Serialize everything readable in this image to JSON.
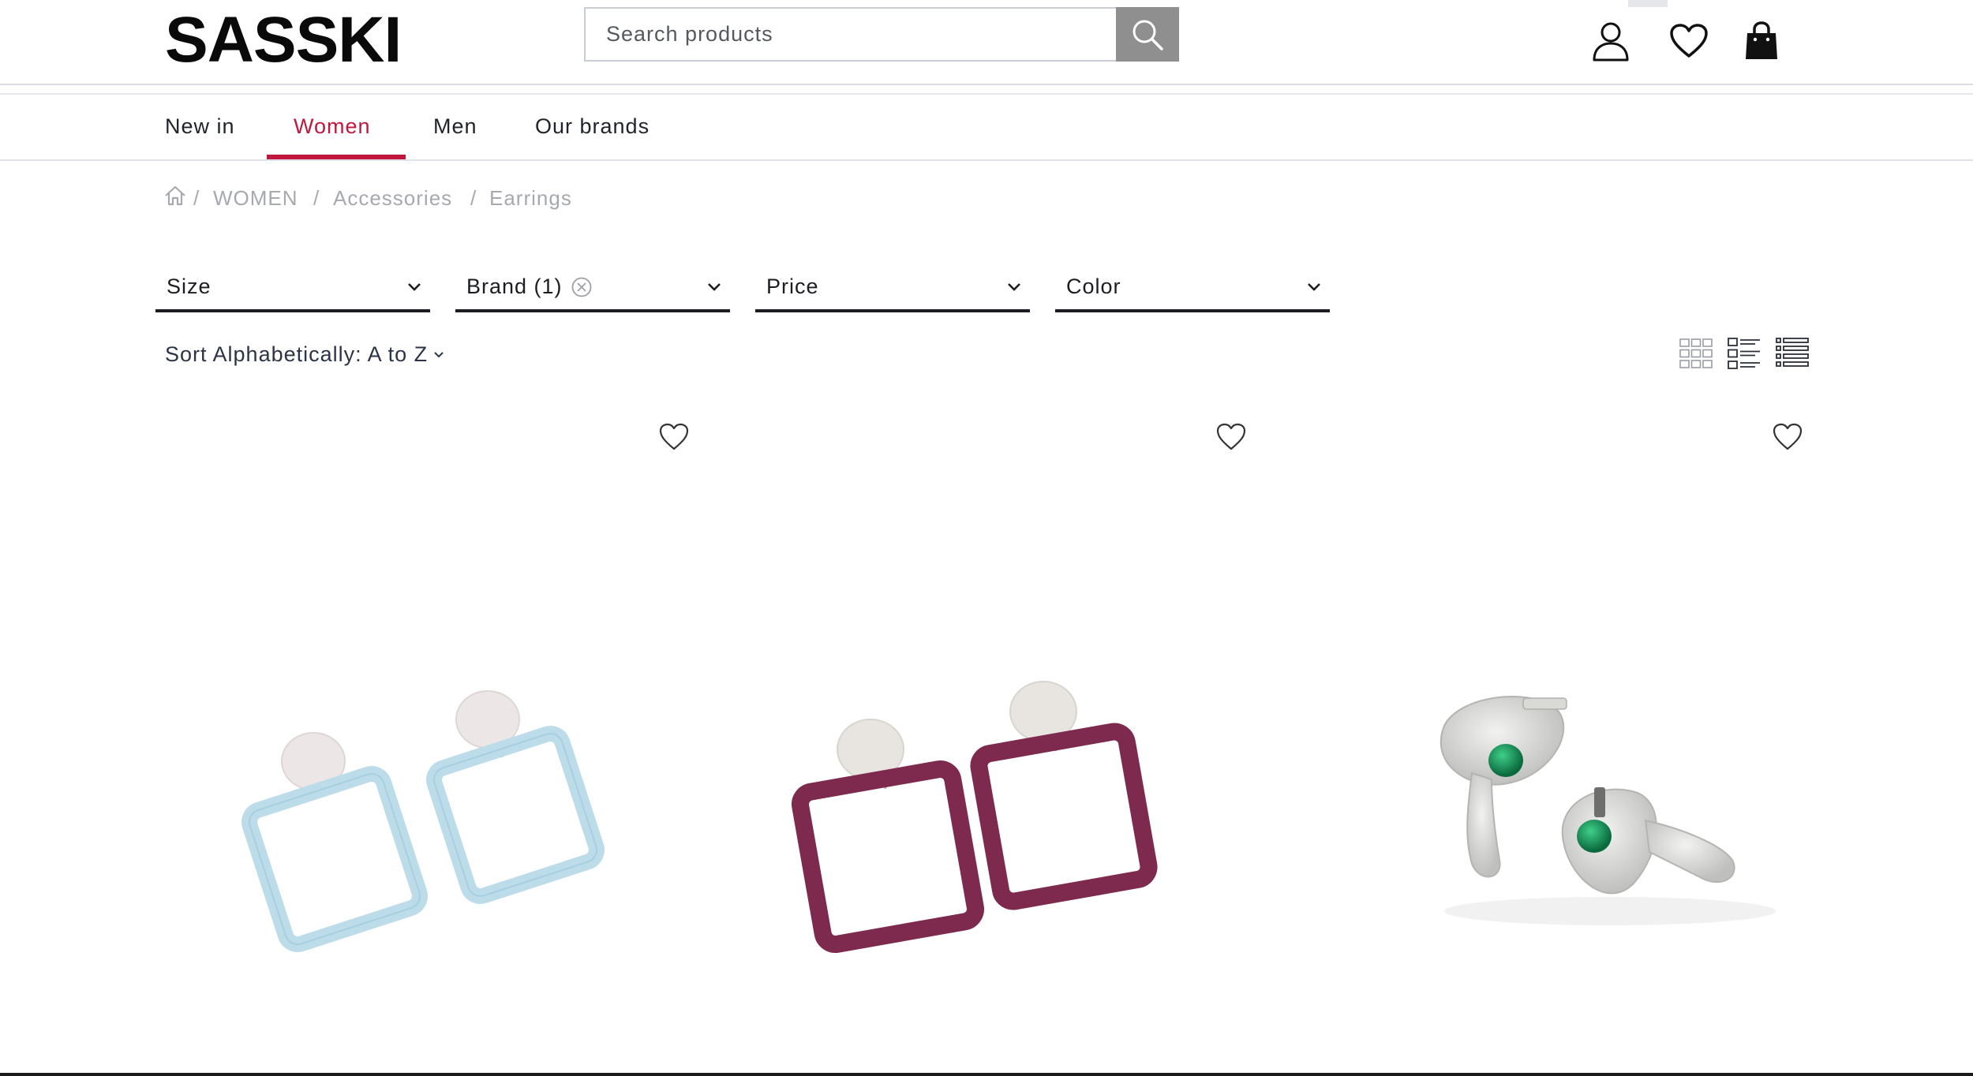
{
  "header": {
    "logo": "SASSKI",
    "search_placeholder": "Search products",
    "icons": [
      "user-icon",
      "heart-icon",
      "shopping-bag-icon"
    ]
  },
  "nav": {
    "items": [
      {
        "label": "New in",
        "active": false
      },
      {
        "label": "Women",
        "active": true
      },
      {
        "label": "Men",
        "active": false
      },
      {
        "label": "Our brands",
        "active": false
      }
    ],
    "accent_color": "#c0173f"
  },
  "breadcrumb": {
    "items": [
      "WOMEN",
      "Accessories",
      "Earrings"
    ],
    "separator": "/"
  },
  "filters": [
    {
      "label": "Size"
    },
    {
      "label": "Brand (1)",
      "clearable": true
    },
    {
      "label": "Price"
    },
    {
      "label": "Color"
    }
  ],
  "sort": {
    "label": "Sort Alphabetically: A to Z"
  },
  "view_modes": [
    "grid-view-icon",
    "list-view-icon",
    "compact-list-icon"
  ],
  "products": [
    {
      "image": "light-blue square hoop earrings with round stud",
      "color": "#bcdcea"
    },
    {
      "image": "burgundy square hoop earrings with round stud",
      "color": "#7d2a4e"
    },
    {
      "image": "silver sculpted earrings with green stone",
      "color": "#c8c8c8"
    }
  ]
}
